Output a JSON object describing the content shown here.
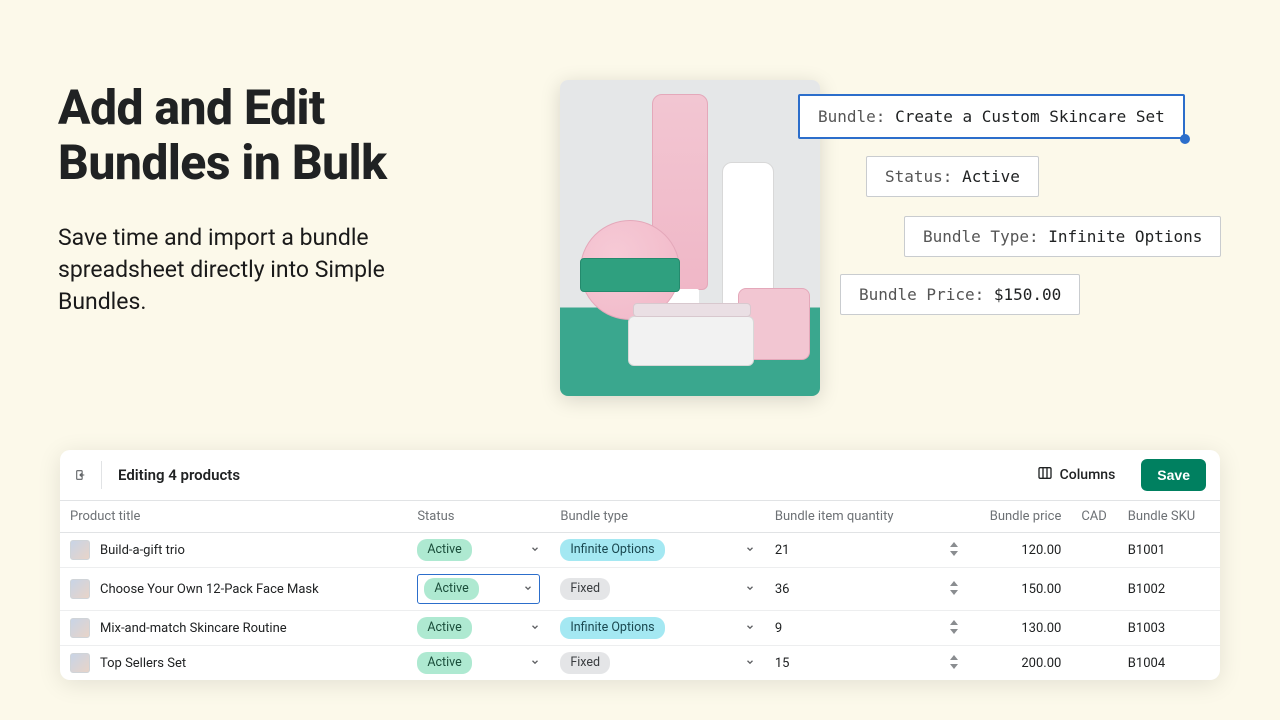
{
  "hero": {
    "title": "Add and Edit Bundles in Bulk",
    "subtitle": "Save time and import a bundle spreadsheet directly into Simple Bundles."
  },
  "tags": {
    "bundle_label": "Bundle:",
    "bundle_value": "Create a Custom Skincare Set",
    "status_label": "Status:",
    "status_value": "Active",
    "type_label": "Bundle Type:",
    "type_value": "Infinite Options",
    "price_label": "Bundle Price:",
    "price_value": "$150.00"
  },
  "editor": {
    "title": "Editing 4 products",
    "columns_btn": "Columns",
    "save_btn": "Save",
    "currency": "CAD",
    "headers": {
      "title": "Product title",
      "status": "Status",
      "type": "Bundle type",
      "qty": "Bundle item quantity",
      "price": "Bundle price",
      "sku": "Bundle SKU"
    },
    "rows": [
      {
        "title": "Build-a-gift trio",
        "status": "Active",
        "type": "Infinite Options",
        "type_style": "teal",
        "qty": "21",
        "price": "120.00",
        "sku": "B1001"
      },
      {
        "title": "Choose Your Own 12-Pack Face Mask",
        "status": "Active",
        "type": "Fixed",
        "type_style": "gray",
        "qty": "36",
        "price": "150.00",
        "sku": "B1002",
        "focus": true
      },
      {
        "title": "Mix-and-match Skincare Routine",
        "status": "Active",
        "type": "Infinite Options",
        "type_style": "teal",
        "qty": "9",
        "price": "130.00",
        "sku": "B1003"
      },
      {
        "title": "Top Sellers Set",
        "status": "Active",
        "type": "Fixed",
        "type_style": "gray",
        "qty": "15",
        "price": "200.00",
        "sku": "B1004"
      }
    ]
  }
}
